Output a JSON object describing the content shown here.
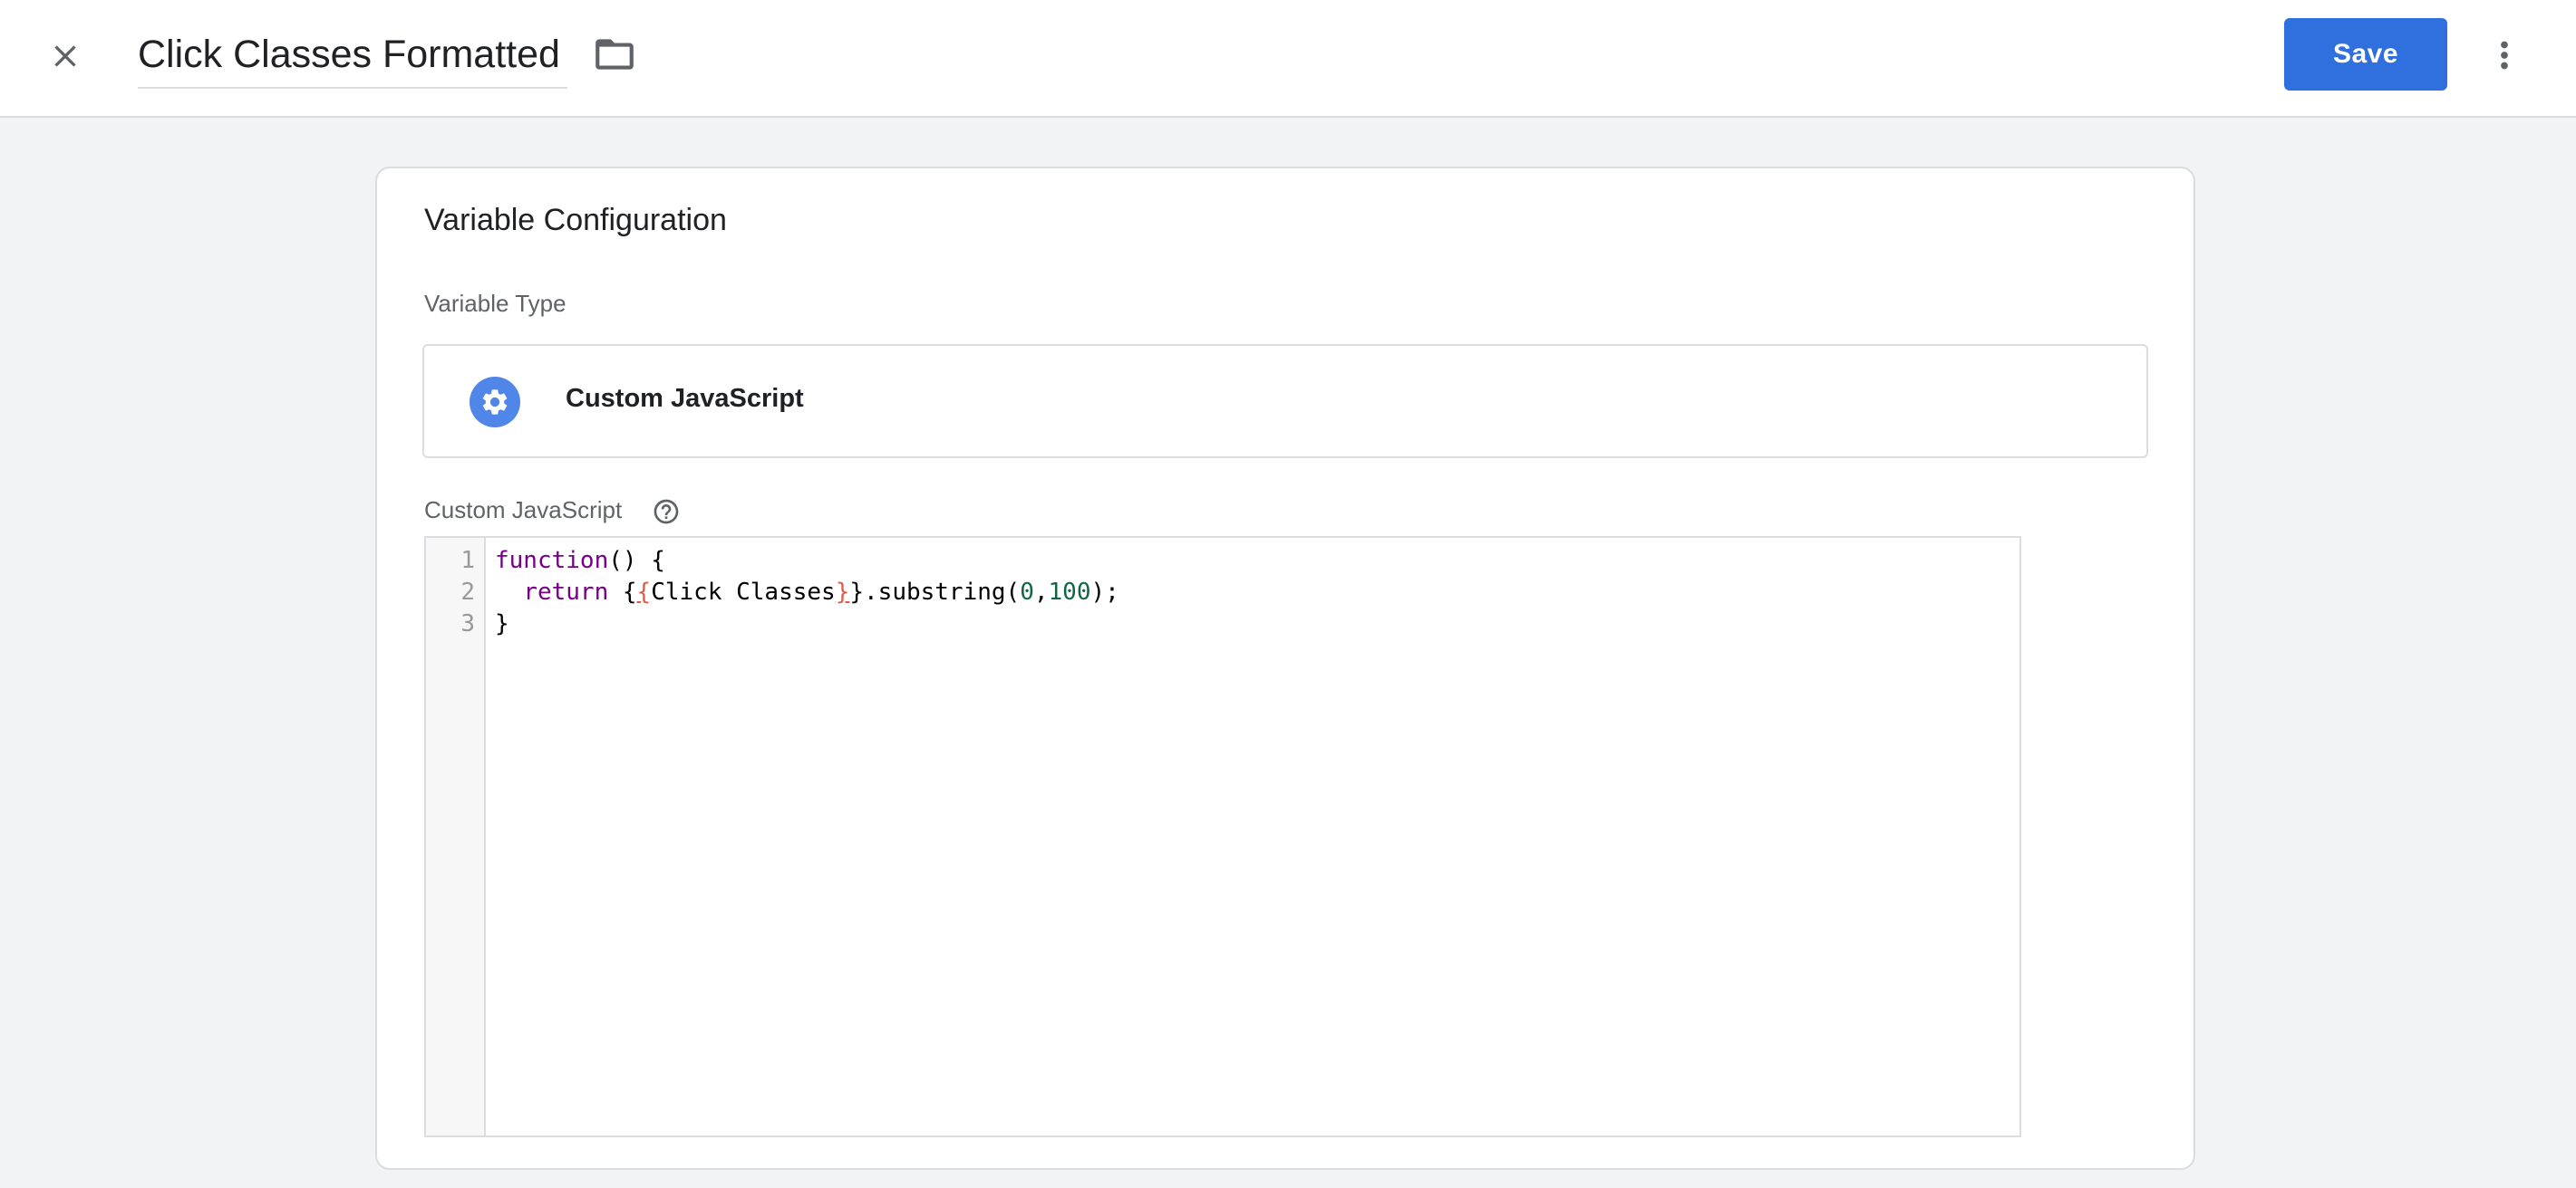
{
  "header": {
    "title": "Click Classes Formatted",
    "save_label": "Save",
    "accent_color": "#2f6fde"
  },
  "card": {
    "title": "Variable Configuration",
    "variable_type_label": "Variable Type",
    "variable_type_name": "Custom JavaScript",
    "variable_type_icon": "gear-icon",
    "js_label": "Custom JavaScript"
  },
  "editor": {
    "line_numbers": [
      "1",
      "2",
      "3"
    ],
    "lines": [
      {
        "tokens": [
          {
            "text": "function",
            "kind": "keyword"
          },
          {
            "text": "() {",
            "kind": "plain"
          }
        ]
      },
      {
        "tokens": [
          {
            "text": "  ",
            "kind": "plain"
          },
          {
            "text": "return",
            "kind": "keyword"
          },
          {
            "text": " {",
            "kind": "plain"
          },
          {
            "text": "{",
            "kind": "brace-err"
          },
          {
            "text": "Click Classes",
            "kind": "plain"
          },
          {
            "text": "}",
            "kind": "brace-err"
          },
          {
            "text": "}.substring(",
            "kind": "plain"
          },
          {
            "text": "0",
            "kind": "number"
          },
          {
            "text": ",",
            "kind": "plain"
          },
          {
            "text": "100",
            "kind": "number"
          },
          {
            "text": ");",
            "kind": "plain"
          }
        ]
      },
      {
        "tokens": [
          {
            "text": "}",
            "kind": "plain"
          }
        ]
      }
    ]
  }
}
